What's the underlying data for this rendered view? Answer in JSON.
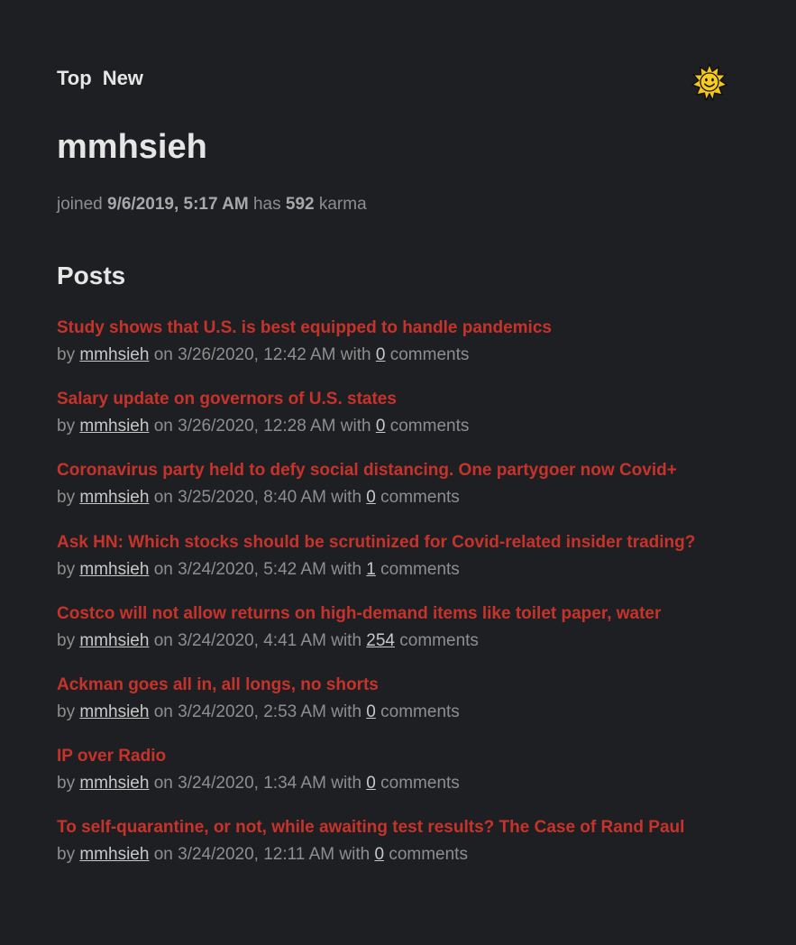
{
  "nav": {
    "top_label": "Top",
    "new_label": "New"
  },
  "theme_icon": "sun-icon",
  "profile": {
    "username": "mmhsieh",
    "joined_prefix": "joined",
    "joined_date": "9/6/2019, 5:17 AM",
    "karma_prefix": "has",
    "karma": "592",
    "karma_suffix": "karma"
  },
  "posts_heading": "Posts",
  "posts": [
    {
      "title": "Study shows that U.S. is best equipped to handle pandemics",
      "by": "by",
      "author": "mmhsieh",
      "on": "on",
      "date": "3/26/2020, 12:42 AM",
      "with": "with",
      "comments_count": "0",
      "comments_suffix": "comments"
    },
    {
      "title": "Salary update on governors of U.S. states",
      "by": "by",
      "author": "mmhsieh",
      "on": "on",
      "date": "3/26/2020, 12:28 AM",
      "with": "with",
      "comments_count": "0",
      "comments_suffix": "comments"
    },
    {
      "title": "Coronavirus party held to defy social distancing. One partygoer now Covid+",
      "by": "by",
      "author": "mmhsieh",
      "on": "on",
      "date": "3/25/2020, 8:40 AM",
      "with": "with",
      "comments_count": "0",
      "comments_suffix": "comments"
    },
    {
      "title": "Ask HN: Which stocks should be scrutinized for Covid-related insider trading?",
      "by": "by",
      "author": "mmhsieh",
      "on": "on",
      "date": "3/24/2020, 5:42 AM",
      "with": "with",
      "comments_count": "1",
      "comments_suffix": "comments"
    },
    {
      "title": "Costco will not allow returns on high-demand items like toilet paper, water",
      "by": "by",
      "author": "mmhsieh",
      "on": "on",
      "date": "3/24/2020, 4:41 AM",
      "with": "with",
      "comments_count": "254",
      "comments_suffix": "comments"
    },
    {
      "title": "Ackman goes all in, all longs, no shorts",
      "by": "by",
      "author": "mmhsieh",
      "on": "on",
      "date": "3/24/2020, 2:53 AM",
      "with": "with",
      "comments_count": "0",
      "comments_suffix": "comments"
    },
    {
      "title": "IP over Radio",
      "by": "by",
      "author": "mmhsieh",
      "on": "on",
      "date": "3/24/2020, 1:34 AM",
      "with": "with",
      "comments_count": "0",
      "comments_suffix": "comments"
    },
    {
      "title": "To self-quarantine, or not, while awaiting test results? The Case of Rand Paul",
      "by": "by",
      "author": "mmhsieh",
      "on": "on",
      "date": "3/24/2020, 12:11 AM",
      "with": "with",
      "comments_count": "0",
      "comments_suffix": "comments"
    }
  ],
  "colors": {
    "background": "#1e1f22",
    "title_red": "#c7332b",
    "heading_text": "#e6e6e6",
    "meta_text": "#8e8e8e"
  }
}
